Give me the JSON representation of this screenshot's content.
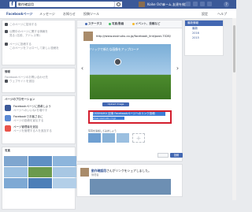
{
  "topbar": {
    "search_value": "動作確認用",
    "user_name": "Koike Ochu",
    "home_label": "ホーム",
    "friend_label": "友達を検索",
    "help_label": "?"
  },
  "page_nav": {
    "tabs": [
      "Facebookページ",
      "メッセージ",
      "お知らせ",
      "投稿ツール"
    ],
    "settings": "設定",
    "help": "ヘルプ"
  },
  "left": {
    "lines": [
      "このページに招待する",
      "公開中のページに関する情報を",
      "見る  (名前、アドレス等)",
      "ページに投稿する",
      "このページをフォローして新しい投稿を"
    ],
    "section1_title": "情報",
    "facebook_page_note": "Facebookページのお問い合わせ先",
    "website_label": "ウェブサイトを追加",
    "promo_title": "ページのプロモーション",
    "promos": [
      {
        "title": "Facebookページに誘導しよう",
        "sub": "ページへのいいね!を増やす",
        "color": "#3b5998"
      },
      {
        "title": "Facebookでお客さまに",
        "sub": "ページの投稿を宣伝する",
        "color": "#5b8ad4"
      },
      {
        "title": "ページ管理者を追加",
        "sub": "ページを管理する人を追加する",
        "color": "#e9534a"
      }
    ],
    "photos_title": "写真"
  },
  "composer": {
    "tabs": [
      "ステータス",
      "写真/動画",
      "イベント、投稿など"
    ],
    "url": "http://www.ossinuku.co.jp/facebook_link/post-7026/",
    "overlay_text": "クリックで新たな画像をアップロード",
    "upload_caption": "Upload image",
    "selected_title": "OSSINUKU 記事 Facebookページへのリンク投稿",
    "selected_sub": "www.ossinuku.co.jp",
    "thumbnail_label": "写真を追加してみましょう",
    "add_symbol": "+",
    "post_button": "投稿"
  },
  "feed": {
    "author": "動作確認用",
    "snippet": "さんがリンクをシェアしました。",
    "sub": "管理者"
  },
  "right": {
    "audience_button": "最新情報",
    "items": [
      "最新",
      "2016",
      "2015"
    ]
  },
  "colors": {
    "header_blue": "#3b5998",
    "highlight_red": "#d31e2e",
    "selection_blue": "#3e7dd6"
  }
}
